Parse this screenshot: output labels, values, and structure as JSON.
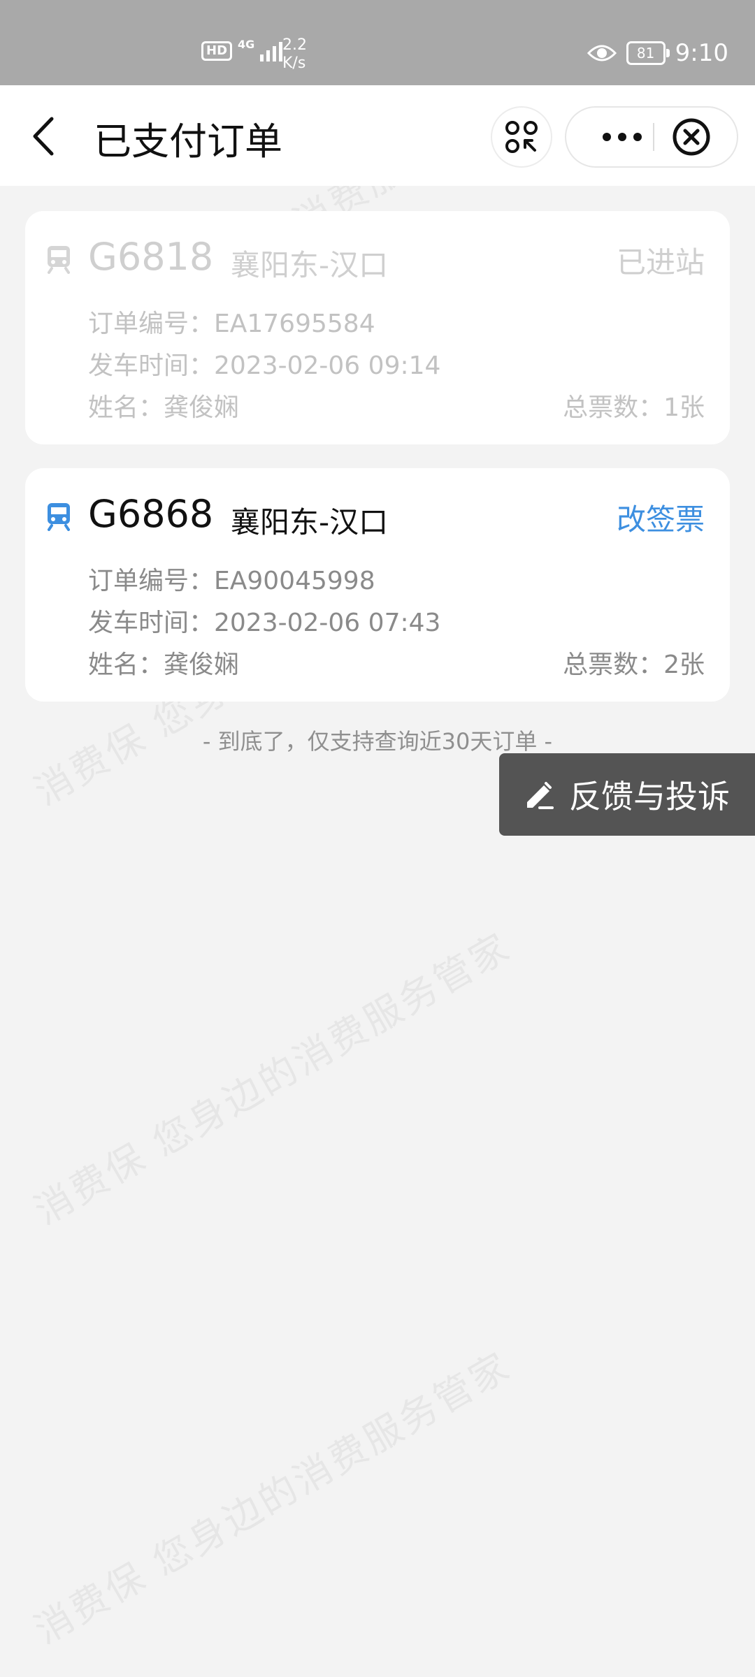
{
  "status_bar": {
    "hd": "HD",
    "net": "4G",
    "speed_value": "2.2",
    "speed_unit": "K/s",
    "battery": "81",
    "time": "9:10"
  },
  "header": {
    "title": "已支付订单"
  },
  "orders": [
    {
      "train": "G6818",
      "route": "襄阳东-汉口",
      "status": "已进站",
      "order_no": "订单编号：EA17695584",
      "depart": "发车时间：2023-02-06 09:14",
      "name": "姓名：龚俊娴",
      "count": "总票数：1张"
    },
    {
      "train": "G6868",
      "route": "襄阳东-汉口",
      "status": "改签票",
      "order_no": "订单编号：EA90045998",
      "depart": "发车时间：2023-02-06 07:43",
      "name": "姓名：龚俊娴",
      "count": "总票数：2张"
    }
  ],
  "footer_note": "- 到底了，仅支持查询近30天订单 -",
  "feedback_button": "反馈与投诉",
  "watermark_line_1": "消费保 您身边的消费服务管家",
  "watermark_line_2": "消费保 您身边的消费服务管家",
  "watermark_line_3": "消费保 您身边的消费服务管家",
  "watermark_line_4": "消费保 您身边的消费服务管家",
  "colors": {
    "accent_blue": "#3d8fe0",
    "status_bar": "#a9a9a9",
    "feedback_bg": "#545454"
  }
}
